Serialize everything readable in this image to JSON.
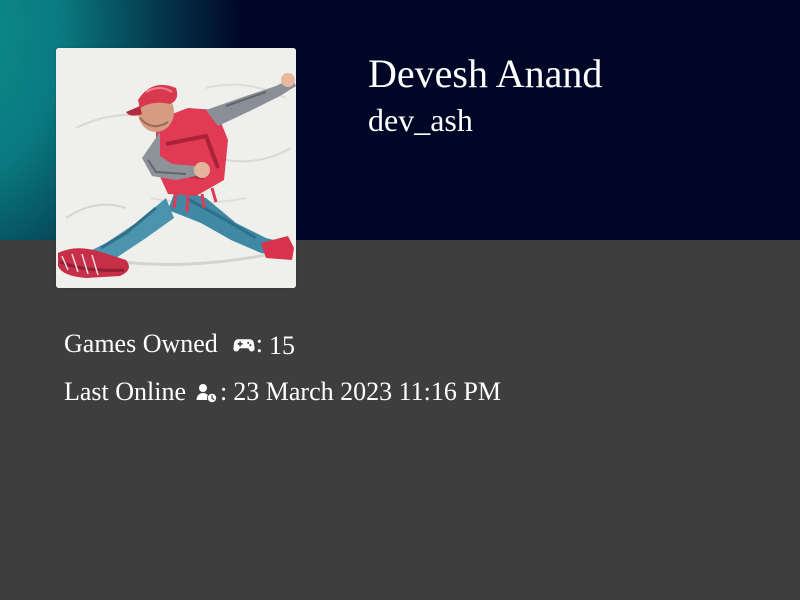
{
  "profile": {
    "name": "Devesh Anand",
    "username": "dev_ash",
    "avatar_alt": "avatar"
  },
  "stats": {
    "games_owned": {
      "label": "Games Owned",
      "icon": "gamepad-icon",
      "separator": ":",
      "value": "15"
    },
    "last_online": {
      "label": "Last Online",
      "icon": "user-clock-icon",
      "separator": ":",
      "value": "23 March 2023 11:16 PM"
    }
  },
  "colors": {
    "background": "#3e3e3e",
    "banner": "#000726",
    "banner_accent": "#0c8d8b",
    "text": "#ffffff"
  }
}
